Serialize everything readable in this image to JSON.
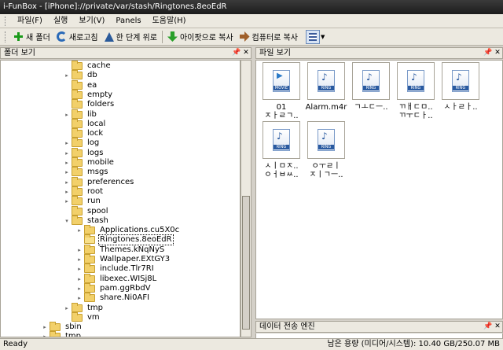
{
  "window": {
    "title": "i-FunBox - [iPhone]://private/var/stash/Ringtones.8eoEdR"
  },
  "menu": [
    "파일(F)",
    "실행",
    "보기(V)",
    "Panels",
    "도움말(H)"
  ],
  "toolbar": {
    "new_folder": "새 폴더",
    "refresh": "새로고침",
    "up": "한 단계 위로",
    "copy_to_iphone": "아이팟으로 복사",
    "copy_to_pc": "컴퓨터로 복사"
  },
  "folder_panel": {
    "title": "폴더 보기"
  },
  "file_panel": {
    "title": "파일 보기"
  },
  "transfer_panel": {
    "title": "데이터 전송 엔진"
  },
  "tree": [
    {
      "label": "cache",
      "level": 2,
      "exp": ""
    },
    {
      "label": "db",
      "level": 2,
      "exp": "+"
    },
    {
      "label": "ea",
      "level": 2,
      "exp": ""
    },
    {
      "label": "empty",
      "level": 2,
      "exp": ""
    },
    {
      "label": "folders",
      "level": 2,
      "exp": ""
    },
    {
      "label": "lib",
      "level": 2,
      "exp": "+"
    },
    {
      "label": "local",
      "level": 2,
      "exp": ""
    },
    {
      "label": "lock",
      "level": 2,
      "exp": ""
    },
    {
      "label": "log",
      "level": 2,
      "exp": "+"
    },
    {
      "label": "logs",
      "level": 2,
      "exp": "+"
    },
    {
      "label": "mobile",
      "level": 2,
      "exp": "+"
    },
    {
      "label": "msgs",
      "level": 2,
      "exp": "+"
    },
    {
      "label": "preferences",
      "level": 2,
      "exp": "+"
    },
    {
      "label": "root",
      "level": 2,
      "exp": "+"
    },
    {
      "label": "run",
      "level": 2,
      "exp": "+"
    },
    {
      "label": "spool",
      "level": 2,
      "exp": ""
    },
    {
      "label": "stash",
      "level": 2,
      "exp": "-"
    },
    {
      "label": "Applications.cu5X0c",
      "level": 3,
      "exp": "+"
    },
    {
      "label": "Ringtones.8eoEdR",
      "level": 3,
      "exp": "",
      "selected": true
    },
    {
      "label": "Themes.kNqNyS",
      "level": 3,
      "exp": "+"
    },
    {
      "label": "Wallpaper.EXtGY3",
      "level": 3,
      "exp": "+"
    },
    {
      "label": "include.Tlr7RI",
      "level": 3,
      "exp": "+"
    },
    {
      "label": "libexec.WISj8L",
      "level": 3,
      "exp": "+"
    },
    {
      "label": "pam.ggRbdV",
      "level": 3,
      "exp": "+"
    },
    {
      "label": "share.Ni0AFI",
      "level": 3,
      "exp": "+"
    },
    {
      "label": "tmp",
      "level": 2,
      "exp": "+"
    },
    {
      "label": "vm",
      "level": 2,
      "exp": ""
    },
    {
      "label": "sbin",
      "level": 1,
      "exp": "+"
    },
    {
      "label": "tmp",
      "level": 1,
      "exp": "+"
    }
  ],
  "files": [
    {
      "name": "01\nㅈㅏㄹㄱ..",
      "type": "movie"
    },
    {
      "name": "Alarm.m4r",
      "type": "ring"
    },
    {
      "name": "ㄱㅗㄷㅡ..",
      "type": "ring"
    },
    {
      "name": "ㄲㅐㄷㅁ..\nㄲㅜㄷㅏ..",
      "type": "ring"
    },
    {
      "name": "ㅅㅏㄹㅏ..",
      "type": "ring"
    },
    {
      "name": "ㅅㅣㅁㅈ..\nㅇㅓㅂㅆ..",
      "type": "ring"
    },
    {
      "name": "ㅇㅜㄹㅣ\nㅈㅣㄱㅡ..",
      "type": "ring"
    }
  ],
  "status": {
    "left": "Ready",
    "right": "남은 용량 (미디어/시스템): 10.40 GB/250.07 MB"
  }
}
